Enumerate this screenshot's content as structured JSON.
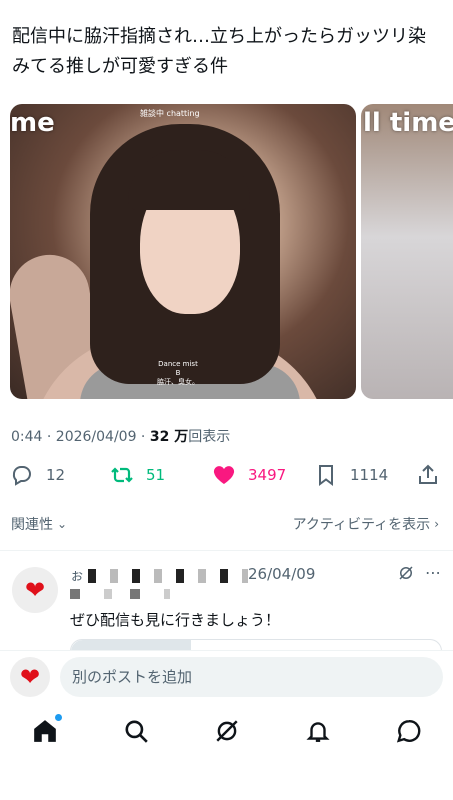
{
  "post": {
    "text": "配信中に脇汗指摘され…立ち上がったらガッツリ染みてる推しが可愛すぎる件"
  },
  "media": {
    "overlay_left": "me",
    "overlay_right": "ll time",
    "small_caption": "雑談中  chatting",
    "sub_caption_1": "Dance mist",
    "sub_caption_2": "B",
    "sub_caption_3": "脇汗、臭女。"
  },
  "meta": {
    "time_date": "0:44 · 2026/04/09 · ",
    "views_count": "32 万",
    "views_label": "回表示"
  },
  "actions": {
    "replies": "12",
    "reposts": "51",
    "likes": "3497",
    "bookmarks": "1114",
    "repost_color": "#00ba7c",
    "like_color": "#f91880"
  },
  "sort": {
    "label": "関連性",
    "activity_label": "アクティビティを表示"
  },
  "reply": {
    "handle_prefix": "ぉ",
    "handle_suffix": "@LxuoyF",
    "date": "26/04/09",
    "text": "ぜひ配信も見に行きましょう！"
  },
  "composer": {
    "placeholder": "別のポストを追加"
  },
  "tabs": {
    "home": "home-icon",
    "search": "search-icon",
    "grok": "grok-icon",
    "notifications": "bell-icon",
    "messages": "message-icon",
    "accent_color": "#1d9bf0"
  }
}
